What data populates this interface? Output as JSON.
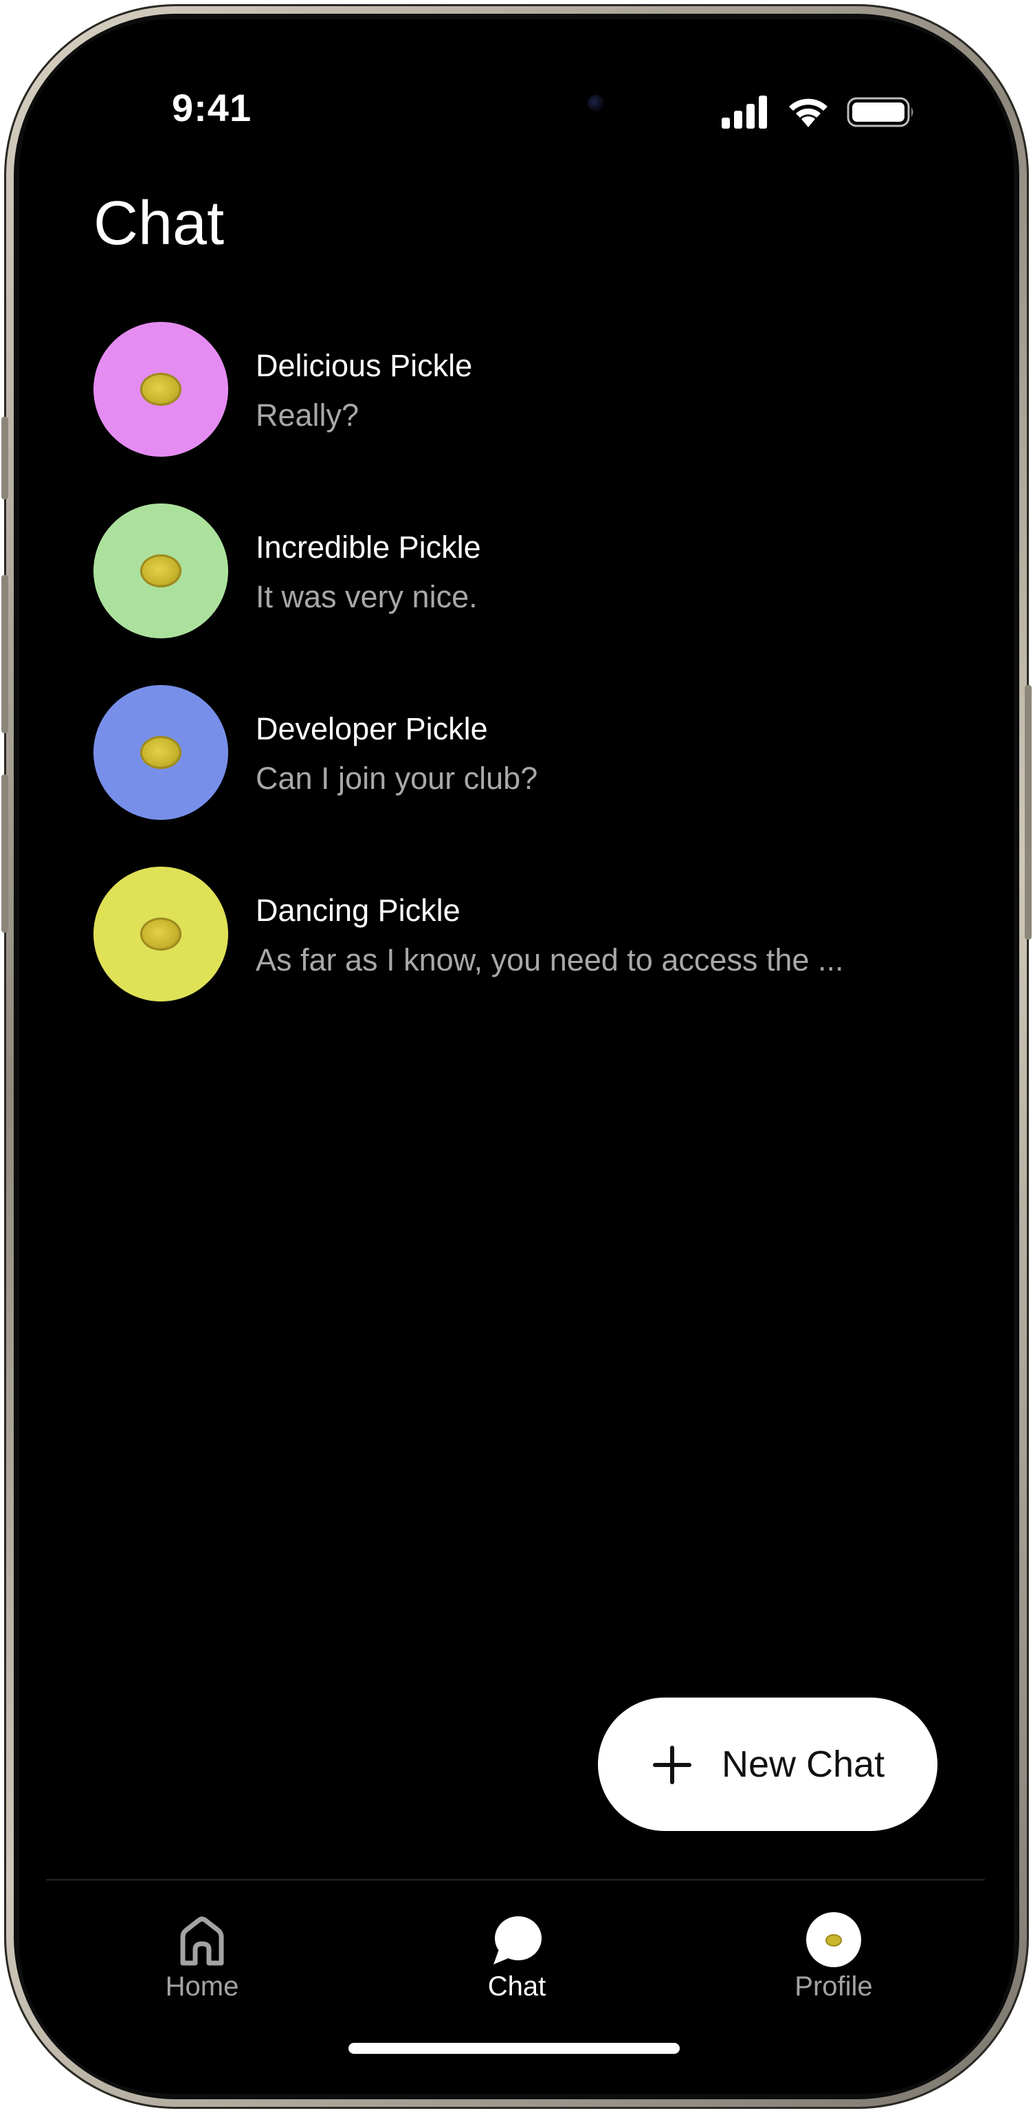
{
  "status_bar": {
    "time": "9:41",
    "icons": [
      "cellular-signal-icon",
      "wifi-icon",
      "battery-icon"
    ]
  },
  "title": "Chat",
  "chats": [
    {
      "name": "Delicious Pickle",
      "preview": "Really?",
      "avatar_color": "#e58cf2"
    },
    {
      "name": "Incredible Pickle",
      "preview": "It was very nice.",
      "avatar_color": "#ace19d"
    },
    {
      "name": "Developer Pickle",
      "preview": "Can I join your club?",
      "avatar_color": "#788fea"
    },
    {
      "name": "Dancing Pickle",
      "preview": "As far as I know, you need to access the ...",
      "avatar_color": "#dfe157"
    }
  ],
  "new_chat_button": {
    "label": "New Chat",
    "icon": "plus-icon"
  },
  "tab_bar": {
    "active": "Chat",
    "tabs": [
      {
        "label": "Home",
        "icon": "house-icon"
      },
      {
        "label": "Chat",
        "icon": "speech-bubble-icon"
      },
      {
        "label": "Profile",
        "icon": "profile-avatar-icon"
      }
    ]
  },
  "colors": {
    "background": "#000000",
    "text_primary": "#ffffff",
    "text_secondary": "#a8a8a8",
    "button_bg": "#ffffff"
  }
}
